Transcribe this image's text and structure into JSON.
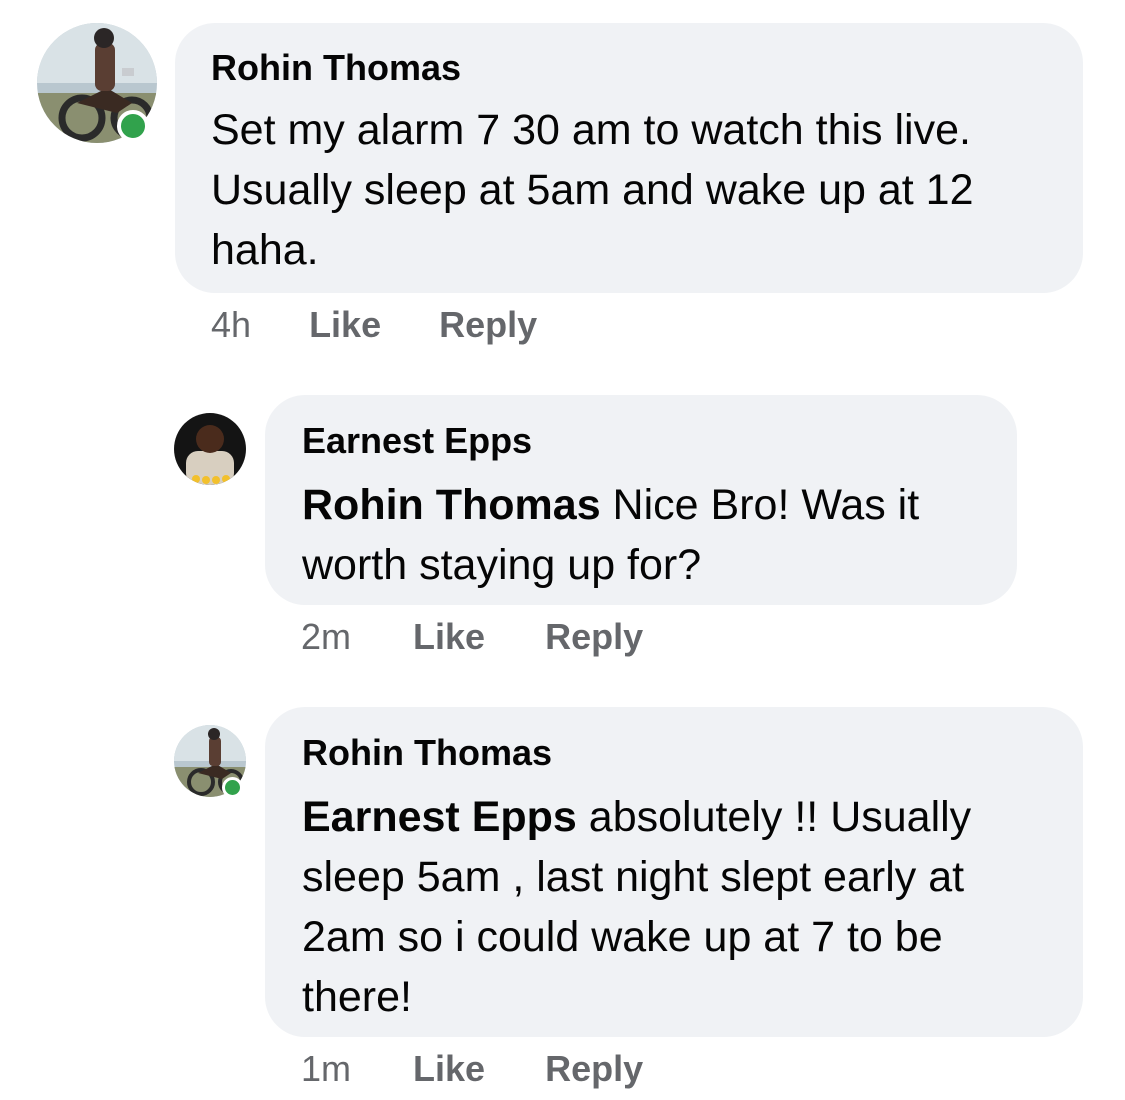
{
  "comments": [
    {
      "author": "Rohin Thomas",
      "text": "Set my alarm 7 30 am to watch this live. Usually sleep at 5am and wake up at 12 haha.",
      "time": "4h",
      "like_label": "Like",
      "reply_label": "Reply",
      "online": true
    },
    {
      "author": "Earnest Epps",
      "mention": "Rohin Thomas",
      "text": " Nice Bro! Was it worth staying up for?",
      "time": "2m",
      "like_label": "Like",
      "reply_label": "Reply",
      "online": false
    },
    {
      "author": "Rohin Thomas",
      "mention": "Earnest Epps",
      "text": " absolutely !! Usually sleep 5am , last night slept early at 2am so i could wake up at 7 to be there!",
      "time": "1m",
      "like_label": "Like",
      "reply_label": "Reply",
      "online": true
    }
  ],
  "colors": {
    "bubble": "#f0f2f5",
    "meta_text": "#65676b",
    "online": "#31a24c"
  }
}
